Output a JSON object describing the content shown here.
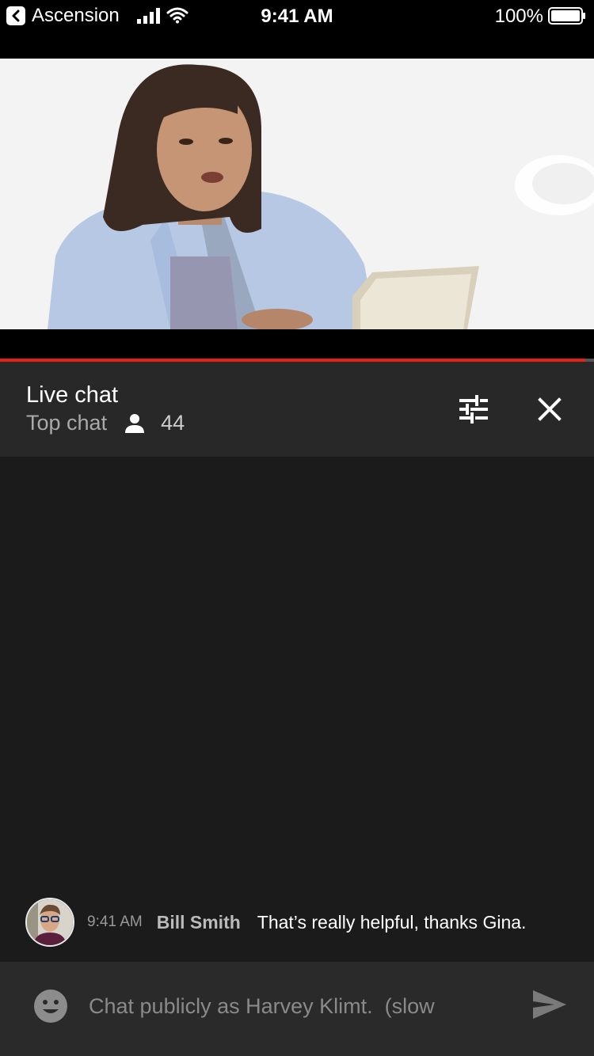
{
  "status_bar": {
    "back_app": "Ascension",
    "time": "9:41 AM",
    "battery": "100%"
  },
  "video": {
    "progress_fraction": 0.985
  },
  "chat_header": {
    "title": "Live chat",
    "mode": "Top chat",
    "viewer_count": "44"
  },
  "messages": [
    {
      "time": "9:41 AM",
      "author": "Bill Smith",
      "text": "That’s really helpful, thanks Gina."
    }
  ],
  "input": {
    "placeholder": "Chat publicly as Harvey Klimt.  (slow"
  },
  "colors": {
    "accent": "#e62117",
    "header_bg": "#282828",
    "chat_bg": "#1b1b1b",
    "input_bg": "#2a2a2a"
  },
  "icons": [
    "back-arrow-icon",
    "signal-icon",
    "wifi-icon",
    "battery-icon",
    "filter-icon",
    "close-icon",
    "person-icon",
    "emoji-icon",
    "send-icon"
  ]
}
